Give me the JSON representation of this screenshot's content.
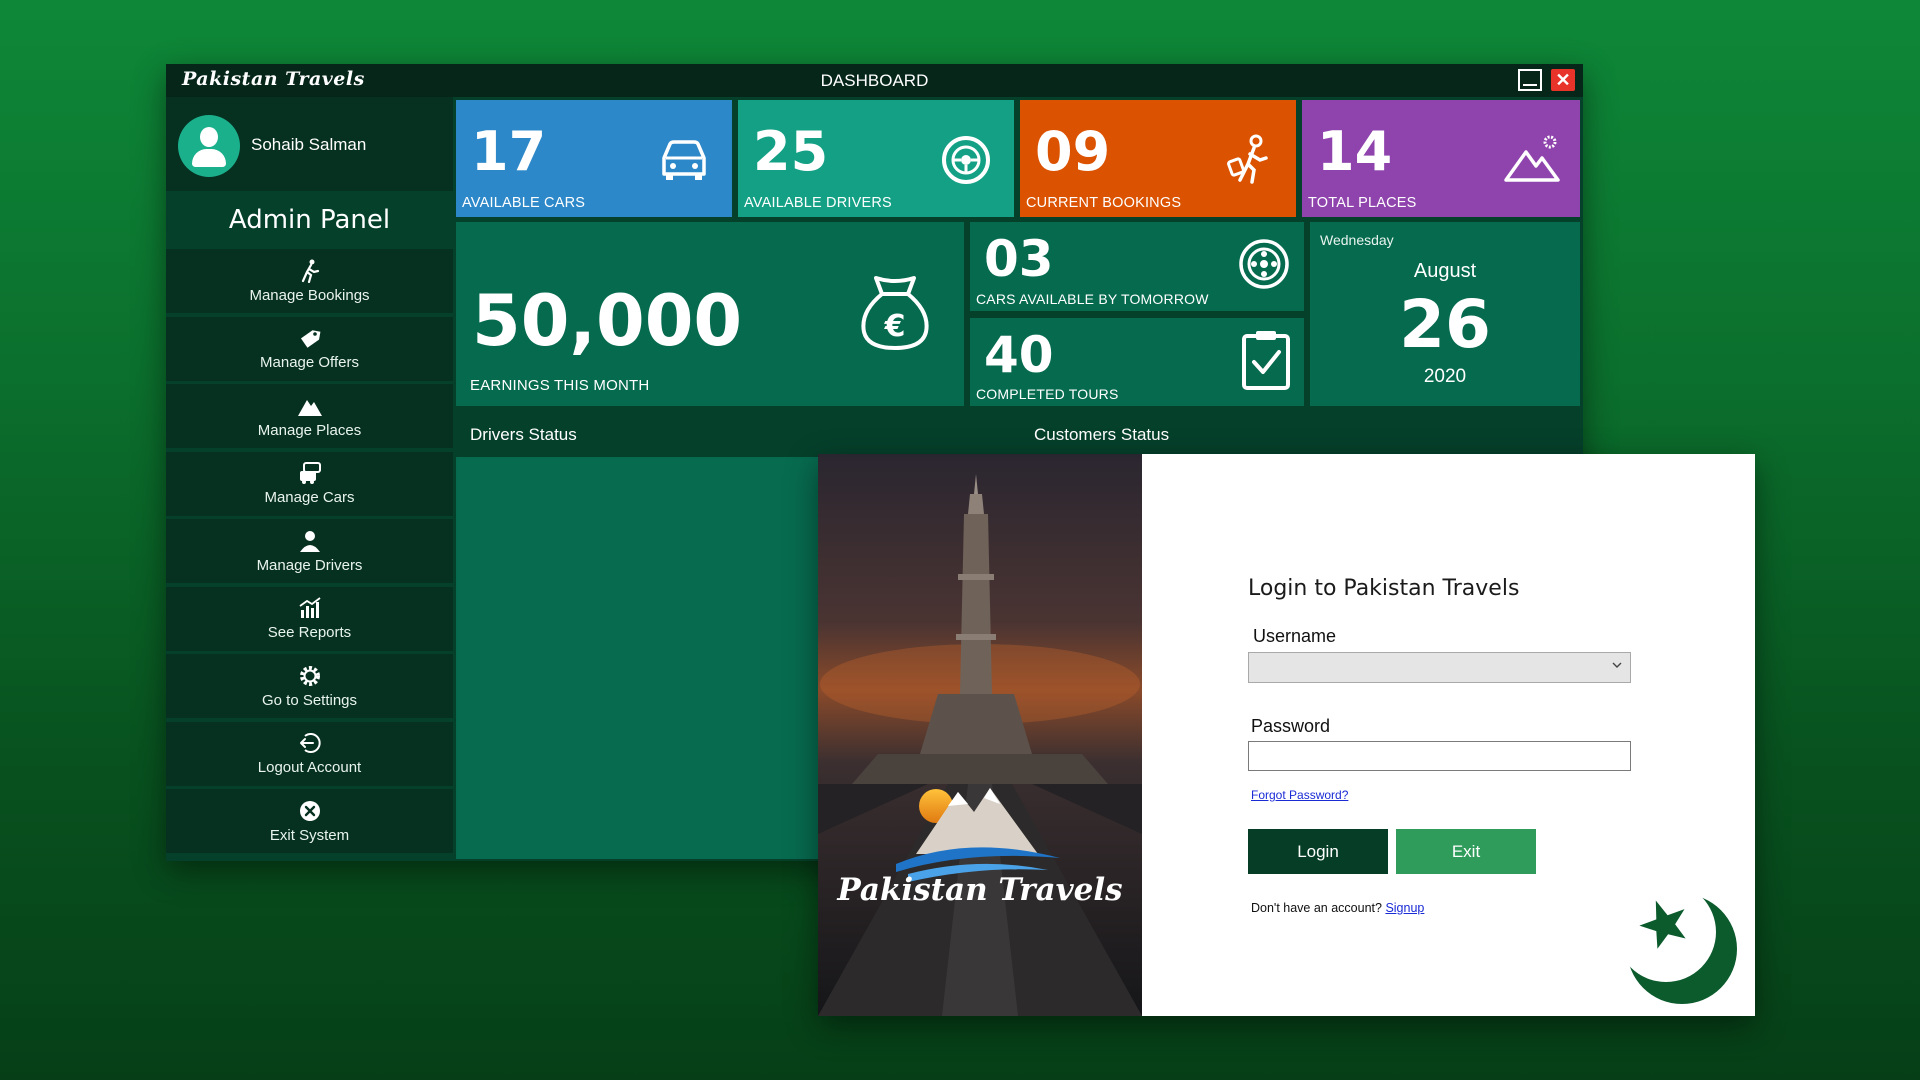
{
  "dashboard": {
    "brand": "Pakistan Travels",
    "title": "DASHBOARD",
    "close_glyph": "✕",
    "user": {
      "name": "Sohaib Salman"
    },
    "panel_title": "Admin Panel",
    "menu": [
      {
        "label": "Manage Bookings",
        "icon": "walking-person-icon"
      },
      {
        "label": "Manage Offers",
        "icon": "tag-icon"
      },
      {
        "label": "Manage Places",
        "icon": "mountain-icon"
      },
      {
        "label": "Manage Cars",
        "icon": "cars-icon"
      },
      {
        "label": "Manage Drivers",
        "icon": "driver-icon"
      },
      {
        "label": "See Reports",
        "icon": "chart-icon"
      },
      {
        "label": "Go to Settings",
        "icon": "gear-icon"
      },
      {
        "label": "Logout Account",
        "icon": "logout-icon"
      },
      {
        "label": "Exit System",
        "icon": "exit-icon"
      }
    ],
    "tiles": {
      "cars": {
        "value": "17",
        "label": "AVAILABLE CARS",
        "color": "#2c88c8"
      },
      "drivers": {
        "value": "25",
        "label": "AVAILABLE DRIVERS",
        "color": "#13a085"
      },
      "bookings": {
        "value": "09",
        "label": "CURRENT BOOKINGS",
        "color": "#db5200"
      },
      "places": {
        "value": "14",
        "label": "TOTAL PLACES",
        "color": "#8f44ad"
      },
      "earnings": {
        "value": "50,000",
        "label": "EARNINGS THIS MONTH"
      },
      "tomorrow": {
        "value": "03",
        "label": "CARS AVAILABLE BY TOMORROW"
      },
      "tours": {
        "value": "40",
        "label": "COMPLETED TOURS"
      }
    },
    "date": {
      "weekday": "Wednesday",
      "month": "August",
      "day": "26",
      "year": "2020"
    },
    "panels": {
      "drivers": "Drivers Status",
      "customers": "Customers Status"
    }
  },
  "login": {
    "brand": "Pakistan Travels",
    "title": "Login to Pakistan Travels",
    "username_label": "Username",
    "username_value": "",
    "password_label": "Password",
    "password_value": "",
    "forgot": "Forgot Password?",
    "login_button": "Login",
    "exit_button": "Exit",
    "no_account": "Don't have an account?",
    "signup": "Signup"
  },
  "colors": {
    "primary": "#05402b",
    "tile": "#066a4e",
    "accent_green": "#2f9c5c",
    "close_red": "#e8332a"
  }
}
